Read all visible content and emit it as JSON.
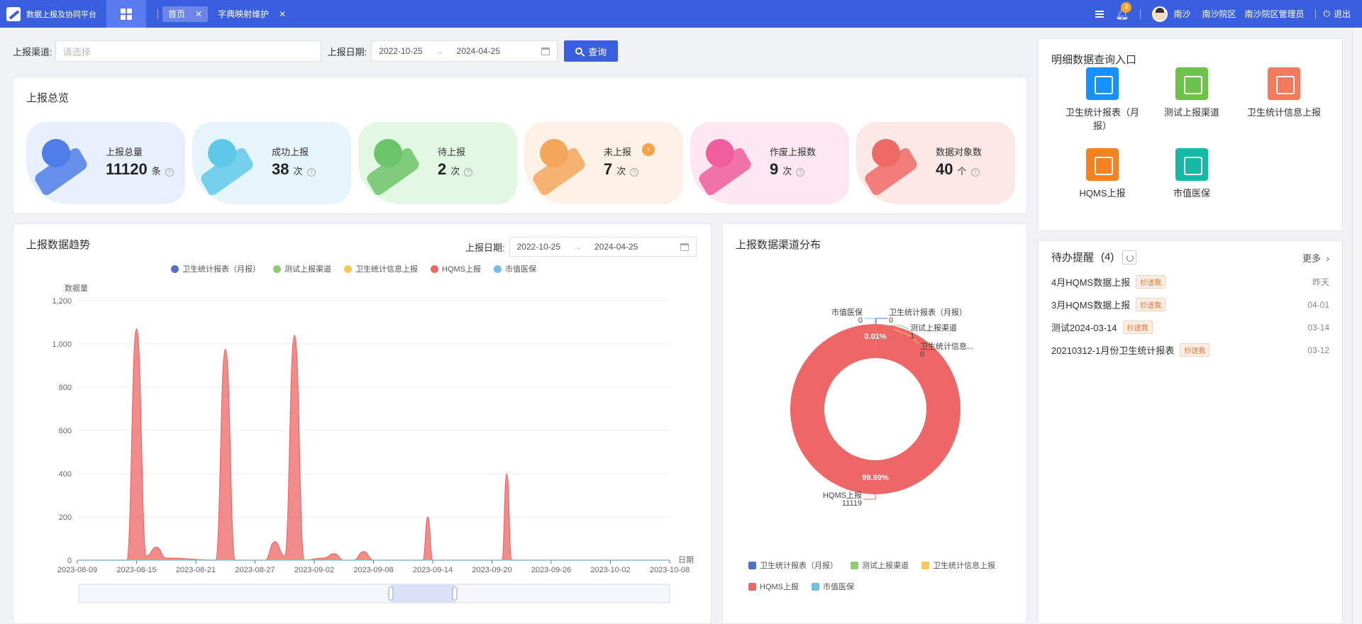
{
  "app": {
    "title": "数据上报及协同平台"
  },
  "tabs": [
    {
      "label": "首页",
      "active": true
    },
    {
      "label": "字典映射维护",
      "active": false
    }
  ],
  "header": {
    "notification_count": "4",
    "user_name": "南沙",
    "hospital": "南沙院区",
    "role": "南沙院区管理员",
    "logout_label": "退出"
  },
  "filters": {
    "channel_label": "上报渠道:",
    "channel_placeholder": "请选择",
    "date_label": "上报日期:",
    "date_start": "2022-10-25",
    "date_end": "2024-04-25",
    "arrow": "→",
    "query_label": "查询"
  },
  "overview": {
    "title": "上报总览",
    "cards": [
      {
        "label": "上报总量",
        "value": "11120",
        "unit": "条",
        "bg": "#e8f0fe",
        "color": "#4f7de8"
      },
      {
        "label": "成功上报",
        "value": "38",
        "unit": "次",
        "bg": "#e6f5fc",
        "color": "#5ec8e8"
      },
      {
        "label": "待上报",
        "value": "2",
        "unit": "次",
        "bg": "#e3f7e5",
        "color": "#6cc46a"
      },
      {
        "label": "未上报",
        "value": "7",
        "unit": "次",
        "bg": "#fdf1e6",
        "color": "#f4a75a"
      },
      {
        "label": "作废上报数",
        "value": "9",
        "unit": "次",
        "bg": "#fde7f1",
        "color": "#ee5d9c"
      },
      {
        "label": "数据对象数",
        "value": "40",
        "unit": "个",
        "bg": "#fce8e6",
        "color": "#ee6a66"
      }
    ]
  },
  "trend": {
    "title": "上报数据趋势",
    "date_label": "上报日期:",
    "date_start": "2022-10-25",
    "date_end": "2024-04-25",
    "arrow": "→"
  },
  "distribution": {
    "title": "上报数据渠道分布"
  },
  "chart_data": [
    {
      "type": "area",
      "ylabel": "数据量",
      "xlabel": "日期",
      "ylim": [
        0,
        1200
      ],
      "yticks": [
        "0",
        "200",
        "400",
        "600",
        "800",
        "1,000",
        "1,200"
      ],
      "xticks": [
        "2023-08-09",
        "2023-08-15",
        "2023-08-21",
        "2023-08-27",
        "2023-09-02",
        "2023-09-08",
        "2023-09-14",
        "2023-09-20",
        "2023-09-26",
        "2023-10-02",
        "2023-10-08"
      ],
      "legend": [
        {
          "name": "卫生统计报表（月报）",
          "color": "#5470c6"
        },
        {
          "name": "测试上报渠道",
          "color": "#91cc75"
        },
        {
          "name": "卫生统计信息上报",
          "color": "#fac858"
        },
        {
          "name": "HQMS上报",
          "color": "#ee6666"
        },
        {
          "name": "市值医保",
          "color": "#73c0de"
        }
      ],
      "series": [
        {
          "name": "HQMS上报",
          "color": "#ee6666",
          "points": [
            [
              0,
              0
            ],
            [
              5,
              0
            ],
            [
              6,
              1070
            ],
            [
              7,
              20
            ],
            [
              8,
              60
            ],
            [
              9,
              10
            ],
            [
              14,
              0
            ],
            [
              15,
              975
            ],
            [
              16,
              0
            ],
            [
              19,
              0
            ],
            [
              20,
              85
            ],
            [
              21,
              20
            ],
            [
              22,
              1040
            ],
            [
              23,
              0
            ],
            [
              25,
              10
            ],
            [
              26,
              30
            ],
            [
              27,
              0
            ],
            [
              28,
              0
            ],
            [
              29,
              40
            ],
            [
              30,
              0
            ],
            [
              35,
              0
            ],
            [
              35.5,
              200
            ],
            [
              36,
              0
            ],
            [
              43,
              0
            ],
            [
              43.5,
              400
            ],
            [
              44,
              0
            ],
            [
              60,
              0
            ]
          ]
        },
        {
          "name": "市值医保",
          "color": "#73c0de",
          "points": [
            [
              0,
              0
            ],
            [
              60,
              0
            ]
          ]
        }
      ],
      "grid": true,
      "legend_position": "top-center",
      "slider": true
    },
    {
      "type": "pie",
      "donut": true,
      "series": [
        {
          "name": "卫生统计报表（月报）",
          "value": 0,
          "color": "#5470c6"
        },
        {
          "name": "测试上报渠道",
          "value": 1,
          "color": "#91cc75"
        },
        {
          "name": "卫生统计信息...",
          "value": 0,
          "color": "#fac858"
        },
        {
          "name": "HQMS上报",
          "value": 11119,
          "color": "#ee6666"
        },
        {
          "name": "市值医保",
          "value": 0,
          "color": "#73c0de"
        }
      ],
      "legend": [
        {
          "name": "卫生统计报表（月报）",
          "color": "#5470c6"
        },
        {
          "name": "测试上报渠道",
          "color": "#91cc75"
        },
        {
          "name": "卫生统计信息上报",
          "color": "#fac858"
        },
        {
          "name": "HQMS上报",
          "color": "#ee6666"
        },
        {
          "name": "市值医保",
          "color": "#73c0de"
        }
      ],
      "labels": {
        "small_pct": "0.01%",
        "large_pct": "99.99%",
        "c1_name": "市值医保",
        "c1_val": "0",
        "c2_name": "卫生统计报表（月报）",
        "c2_val": "0",
        "c3_name": "测试上报渠道",
        "c3_val": "1",
        "c4_name": "卫生统计信息...",
        "c4_val": "0",
        "c5_name": "HQMS上报",
        "c5_val": "11119"
      },
      "legend_position": "bottom"
    }
  ],
  "quick_entry": {
    "title": "明细数据查询入口",
    "items": [
      {
        "label": "卫生统计报表（月报）",
        "color": "#1890ff"
      },
      {
        "label": "测试上报渠道",
        "color": "#6cc24a"
      },
      {
        "label": "卫生统计信息上报",
        "color": "#f37b5d"
      },
      {
        "label": "HQMS上报",
        "color": "#f58220"
      },
      {
        "label": "市值医保",
        "color": "#17b8a6"
      }
    ]
  },
  "todo": {
    "title": "待办提醒",
    "count": "(4)",
    "more_label": "更多",
    "items": [
      {
        "title": "4月HQMS数据上报",
        "tag": "抄送我",
        "date": "昨天"
      },
      {
        "title": "3月HQMS数据上报",
        "tag": "抄送我",
        "date": "04-01"
      },
      {
        "title": "测试2024-03-14",
        "tag": "抄送我",
        "date": "03-14"
      },
      {
        "title": "20210312-1月份卫生统计报表",
        "tag": "抄送我",
        "date": "03-12"
      }
    ]
  }
}
